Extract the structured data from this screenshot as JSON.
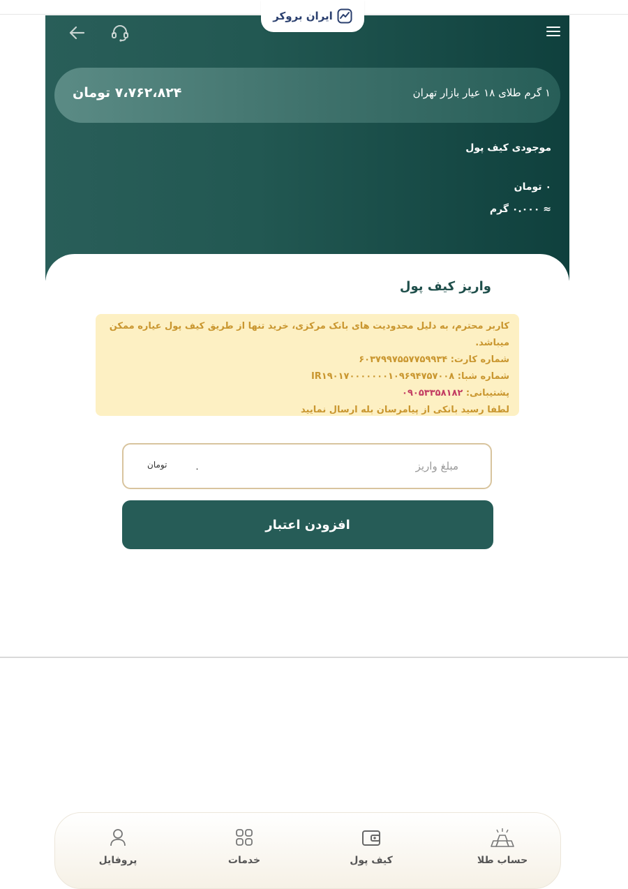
{
  "header": {
    "logo_text": "ایران بروکر",
    "back_icon": "arrow-left-icon",
    "support_icon": "headset-icon",
    "menu_icon": "hamburger-menu-icon"
  },
  "price": {
    "label": "۱ گرم طلای ۱۸ عیار بازار تهران",
    "value": "۷،۷۶۲،۸۲۴ تومان"
  },
  "wallet": {
    "title": "موجودی کیف پول",
    "balance_toman": "۰ تومان",
    "balance_gram": "≈ ۰.۰۰۰ گرم"
  },
  "deposit": {
    "title": "واریز کیف پول",
    "notice": {
      "line1": "کاربر محترم، به دلیل محدودیت های بانک مرکزی، خرید تنها از طریق کیف پول عیاره ممکن میباشد.",
      "card_label": "شماره کارت:",
      "card_number": "۶۰۳۷۹۹۷۵۵۷۷۵۹۹۳۴",
      "sheba_label": "شماره شبا:",
      "sheba_number": "IR۱۹۰۱۷۰۰۰۰۰۰۰۱۰۹۶۹۴۷۵۷۰۰۸",
      "support_label": "پشتیبانی:",
      "support_phone": "۰۹۰۵۳۳۵۸۱۸۲",
      "last_line": "لطفا رسید بانکی از پیامرسان بله ارسال نمایید"
    },
    "amount_placeholder": "مبلغ واریز",
    "amount_value": "۰",
    "amount_unit": "تومان",
    "submit_label": "افزودن اعتبار"
  },
  "bottom_nav": [
    {
      "label": "حساب طلا",
      "icon": "gold-bars-icon"
    },
    {
      "label": "کیف پول",
      "icon": "wallet-icon"
    },
    {
      "label": "خدمات",
      "icon": "grid-icon"
    },
    {
      "label": "پروفایل",
      "icon": "user-icon"
    }
  ],
  "colors": {
    "primary": "#265c57",
    "notice_bg": "#fdf0c3",
    "notice_text": "#c9962f",
    "notice_highlight": "#c23d63"
  }
}
